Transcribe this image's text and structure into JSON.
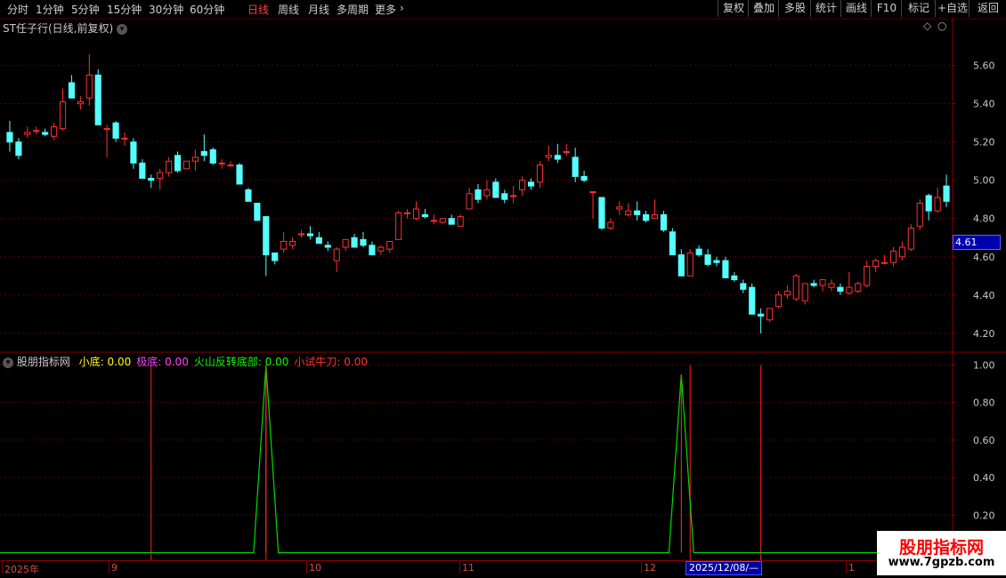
{
  "toolbar": {
    "periods": [
      {
        "label": "分时",
        "active": false
      },
      {
        "label": "1分钟",
        "active": false
      },
      {
        "label": "5分钟",
        "active": false
      },
      {
        "label": "15分钟",
        "active": false
      },
      {
        "label": "30分钟",
        "active": false
      },
      {
        "label": "60分钟",
        "active": false
      },
      {
        "label": "日线",
        "active": true
      },
      {
        "label": "周线",
        "active": false
      },
      {
        "label": "月线",
        "active": false
      },
      {
        "label": "多周期",
        "active": false
      },
      {
        "label": "更多",
        "active": false
      }
    ],
    "actions": [
      "复权",
      "叠加",
      "多股",
      "统计",
      "画线",
      "F10",
      "标记",
      "+自选",
      "返回"
    ]
  },
  "stock_title": "ST任子行(日线,前复权)",
  "indicator_panel": {
    "name": "股朋指标网",
    "fields": [
      {
        "label": "小底:",
        "value": "0.00",
        "color": "#ffff00"
      },
      {
        "label": "极底:",
        "value": "0.00",
        "color": "#ff40ff"
      },
      {
        "label": "火山反转底部:",
        "value": "0.00",
        "color": "#00ff00"
      },
      {
        "label": "小试牛刀:",
        "value": "0.00",
        "color": "#ff3030"
      }
    ]
  },
  "current_price_label": "4.61",
  "date_axis": {
    "ticks": [
      "2025年",
      "9",
      "10",
      "11",
      "12",
      "1"
    ],
    "cursor_label": "2025/12/08/—"
  },
  "watermark": {
    "title": "股朋指标网",
    "url": "www.7gpzb.com"
  },
  "colors": {
    "up": "#ff3030",
    "down": "#54ffff",
    "grid": "#5a0000",
    "axis": "#8b0000"
  },
  "chart_data": {
    "type": "candlestick",
    "y_ticks": [
      "5.60",
      "5.40",
      "5.20",
      "5.00",
      "4.80",
      "4.60",
      "4.40",
      "4.20"
    ],
    "ylim": [
      4.12,
      5.71
    ],
    "ohlc": [
      [
        5.25,
        5.31,
        5.15,
        5.2
      ],
      [
        5.2,
        5.22,
        5.11,
        5.13
      ],
      [
        5.24,
        5.28,
        5.22,
        5.25
      ],
      [
        5.26,
        5.28,
        5.24,
        5.26
      ],
      [
        5.25,
        5.27,
        5.23,
        5.24
      ],
      [
        5.23,
        5.3,
        5.21,
        5.28
      ],
      [
        5.27,
        5.48,
        5.26,
        5.41
      ],
      [
        5.51,
        5.55,
        5.43,
        5.43
      ],
      [
        5.4,
        5.44,
        5.37,
        5.41
      ],
      [
        5.43,
        5.66,
        5.39,
        5.55
      ],
      [
        5.55,
        5.58,
        5.29,
        5.29
      ],
      [
        5.27,
        5.29,
        5.12,
        5.27
      ],
      [
        5.3,
        5.31,
        5.2,
        5.22
      ],
      [
        5.22,
        5.25,
        5.18,
        5.22
      ],
      [
        5.2,
        5.22,
        5.06,
        5.09
      ],
      [
        5.09,
        5.11,
        5.01,
        5.01
      ],
      [
        5.01,
        5.03,
        4.96,
        5.0
      ],
      [
        5.01,
        5.06,
        4.95,
        5.04
      ],
      [
        5.04,
        5.12,
        5.02,
        5.1
      ],
      [
        5.13,
        5.15,
        5.04,
        5.05
      ],
      [
        5.06,
        5.1,
        5.06,
        5.1
      ],
      [
        5.1,
        5.16,
        5.05,
        5.12
      ],
      [
        5.15,
        5.24,
        5.1,
        5.13
      ],
      [
        5.16,
        5.17,
        5.08,
        5.09
      ],
      [
        5.09,
        5.11,
        5.06,
        5.09
      ],
      [
        5.08,
        5.1,
        5.07,
        5.08
      ],
      [
        5.08,
        5.09,
        4.98,
        4.98
      ],
      [
        4.95,
        4.96,
        4.89,
        4.89
      ],
      [
        4.88,
        4.88,
        4.79,
        4.79
      ],
      [
        4.81,
        4.81,
        4.5,
        4.61
      ],
      [
        4.62,
        4.62,
        4.56,
        4.58
      ],
      [
        4.64,
        4.73,
        4.62,
        4.68
      ],
      [
        4.66,
        4.7,
        4.64,
        4.68
      ],
      [
        4.72,
        4.74,
        4.7,
        4.72
      ],
      [
        4.72,
        4.76,
        4.69,
        4.71
      ],
      [
        4.7,
        4.73,
        4.67,
        4.67
      ],
      [
        4.66,
        4.68,
        4.63,
        4.65
      ],
      [
        4.58,
        4.65,
        4.52,
        4.64
      ],
      [
        4.65,
        4.69,
        4.63,
        4.69
      ],
      [
        4.7,
        4.72,
        4.65,
        4.65
      ],
      [
        4.69,
        4.73,
        4.65,
        4.66
      ],
      [
        4.66,
        4.68,
        4.61,
        4.61
      ],
      [
        4.63,
        4.66,
        4.61,
        4.65
      ],
      [
        4.64,
        4.68,
        4.62,
        4.68
      ],
      [
        4.69,
        4.84,
        4.69,
        4.83
      ],
      [
        4.83,
        4.85,
        4.8,
        4.83
      ],
      [
        4.8,
        4.89,
        4.79,
        4.85
      ],
      [
        4.82,
        4.85,
        4.8,
        4.81
      ],
      [
        4.79,
        4.82,
        4.77,
        4.79
      ],
      [
        4.78,
        4.8,
        4.77,
        4.8
      ],
      [
        4.8,
        4.82,
        4.77,
        4.77
      ],
      [
        4.76,
        4.82,
        4.76,
        4.81
      ],
      [
        4.85,
        4.96,
        4.85,
        4.93
      ],
      [
        4.95,
        4.98,
        4.88,
        4.9
      ],
      [
        4.92,
        5.0,
        4.9,
        4.95
      ],
      [
        4.99,
        5.01,
        4.91,
        4.91
      ],
      [
        4.93,
        4.95,
        4.88,
        4.9
      ],
      [
        4.92,
        4.97,
        4.88,
        4.92
      ],
      [
        4.95,
        5.02,
        4.92,
        5.0
      ],
      [
        4.99,
        5.01,
        4.95,
        4.97
      ],
      [
        4.99,
        5.1,
        4.96,
        5.08
      ],
      [
        5.12,
        5.18,
        5.1,
        5.13
      ],
      [
        5.13,
        5.19,
        5.09,
        5.11
      ],
      [
        5.15,
        5.19,
        5.13,
        5.15
      ],
      [
        5.12,
        5.17,
        4.99,
        5.02
      ],
      [
        5.02,
        5.05,
        4.99,
        5.0
      ],
      [
        4.94,
        4.94,
        4.8,
        4.94
      ],
      [
        4.91,
        4.91,
        4.74,
        4.75
      ],
      [
        4.75,
        4.8,
        4.74,
        4.78
      ],
      [
        4.85,
        4.89,
        4.82,
        4.86
      ],
      [
        4.82,
        4.88,
        4.81,
        4.84
      ],
      [
        4.84,
        4.89,
        4.79,
        4.82
      ],
      [
        4.82,
        4.84,
        4.78,
        4.79
      ],
      [
        4.8,
        4.9,
        4.8,
        4.82
      ],
      [
        4.82,
        4.84,
        4.73,
        4.74
      ],
      [
        4.73,
        4.75,
        4.61,
        4.61
      ],
      [
        4.61,
        4.64,
        4.5,
        4.5
      ],
      [
        4.5,
        4.64,
        4.5,
        4.62
      ],
      [
        4.64,
        4.66,
        4.6,
        4.61
      ],
      [
        4.61,
        4.64,
        4.55,
        4.56
      ],
      [
        4.58,
        4.6,
        4.55,
        4.57
      ],
      [
        4.58,
        4.6,
        4.49,
        4.49
      ],
      [
        4.5,
        4.52,
        4.47,
        4.48
      ],
      [
        4.46,
        4.48,
        4.41,
        4.43
      ],
      [
        4.44,
        4.46,
        4.3,
        4.3
      ],
      [
        4.3,
        4.33,
        4.2,
        4.29
      ],
      [
        4.27,
        4.33,
        4.26,
        4.33
      ],
      [
        4.34,
        4.42,
        4.33,
        4.4
      ],
      [
        4.4,
        4.45,
        4.38,
        4.42
      ],
      [
        4.38,
        4.51,
        4.37,
        4.5
      ],
      [
        4.37,
        4.44,
        4.35,
        4.46
      ],
      [
        4.46,
        4.48,
        4.44,
        4.45
      ],
      [
        4.45,
        4.48,
        4.42,
        4.48
      ],
      [
        4.44,
        4.48,
        4.42,
        4.46
      ],
      [
        4.44,
        4.46,
        4.4,
        4.42
      ],
      [
        4.41,
        4.52,
        4.4,
        4.44
      ],
      [
        4.42,
        4.47,
        4.41,
        4.46
      ],
      [
        4.45,
        4.58,
        4.44,
        4.55
      ],
      [
        4.55,
        4.59,
        4.52,
        4.58
      ],
      [
        4.57,
        4.61,
        4.56,
        4.57
      ],
      [
        4.57,
        4.65,
        4.55,
        4.63
      ],
      [
        4.6,
        4.68,
        4.58,
        4.65
      ],
      [
        4.64,
        4.77,
        4.63,
        4.75
      ],
      [
        4.76,
        4.9,
        4.74,
        4.88
      ],
      [
        4.92,
        4.93,
        4.79,
        4.84
      ],
      [
        4.84,
        4.96,
        4.83,
        4.91
      ],
      [
        4.97,
        5.03,
        4.86,
        4.89
      ]
    ]
  },
  "indicator_chart": {
    "y_ticks": [
      "1.00",
      "0.80",
      "0.60",
      "0.40",
      "0.20"
    ],
    "ylim": [
      -0.04,
      1.04
    ],
    "spikes": [
      {
        "index": 29,
        "peak": 1.0,
        "color": "#00ff00"
      },
      {
        "index": 76,
        "peak": 0.95,
        "color": "#00ff00"
      }
    ],
    "red_lines": [
      16,
      29,
      77,
      85
    ]
  }
}
